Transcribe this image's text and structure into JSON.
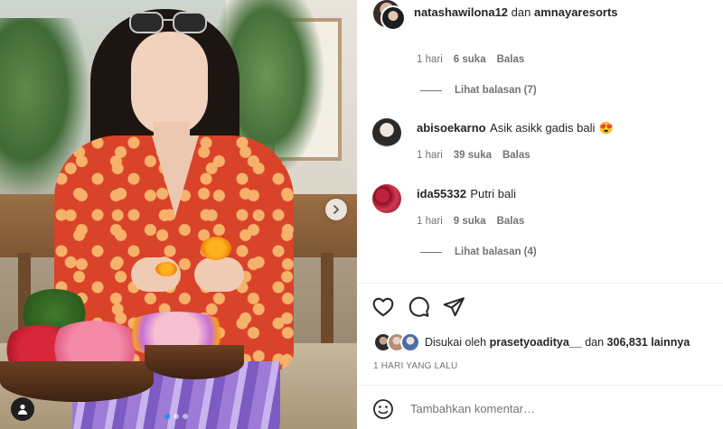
{
  "post": {
    "carousel_dots": 3,
    "active_dot": 0
  },
  "comments": [
    {
      "username": "natashawilona12",
      "joiner": "dan",
      "username2": "amnayaresorts",
      "time": "1 hari",
      "likes": "6 suka",
      "reply": "Balas",
      "view_replies": "Lihat balasan (7)"
    },
    {
      "username": "abisoekarno",
      "text": "Asik asikk gadis bali",
      "emoji": "😍",
      "time": "1 hari",
      "likes": "39 suka",
      "reply": "Balas"
    },
    {
      "username": "ida55332",
      "text": "Putri bali",
      "time": "1 hari",
      "likes": "9 suka",
      "reply": "Balas",
      "view_replies": "Lihat balasan (4)"
    }
  ],
  "actions": {
    "like": "heart-icon",
    "comment": "comment-icon",
    "share": "send-icon"
  },
  "likes": {
    "prefix": "Disukai oleh",
    "user": "prasetyoaditya__",
    "joiner": "dan",
    "count": "306,831 lainnya"
  },
  "timestamp": "1 HARI YANG LALU",
  "composer": {
    "placeholder": "Tambahkan komentar…"
  },
  "colors": {
    "text": "#262626",
    "muted": "#737373",
    "divider": "#efefef",
    "active_dot": "#1e8ef7"
  }
}
